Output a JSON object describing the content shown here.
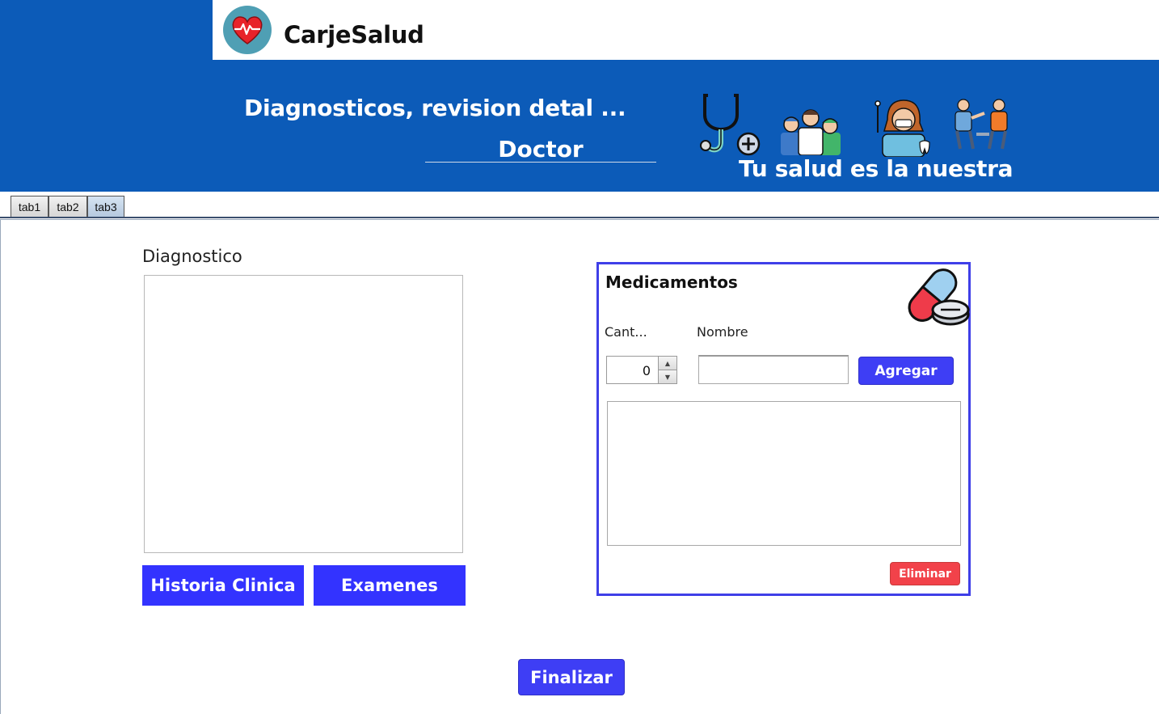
{
  "app": {
    "name": "CarjeSalud"
  },
  "banner": {
    "title": "Diagnosticos, revision detal ...",
    "role": "Doctor",
    "slogan": "Tu salud es la nuestra",
    "icons": [
      "stethoscope-icon",
      "medical-staff-icon",
      "dentist-icon",
      "consultation-icon"
    ]
  },
  "tabs": [
    {
      "label": "tab1",
      "active": false
    },
    {
      "label": "tab2",
      "active": false
    },
    {
      "label": "tab3",
      "active": true
    }
  ],
  "diagnostico": {
    "label": "Diagnostico",
    "value": "",
    "buttons": {
      "historia": "Historia Clinica",
      "examenes": "Examenes"
    }
  },
  "medicamentos": {
    "title": "Medicamentos",
    "cant_label": "Cant...",
    "nombre_label": "Nombre",
    "cantidad": "0",
    "nombre": "",
    "agregar": "Agregar",
    "eliminar": "Eliminar",
    "list": []
  },
  "finalizar": "Finalizar",
  "colors": {
    "header_blue": "#0c5bb8",
    "button_blue": "#3333ff",
    "panel_border": "#3f3fe8",
    "danger_red": "#f2424a"
  }
}
